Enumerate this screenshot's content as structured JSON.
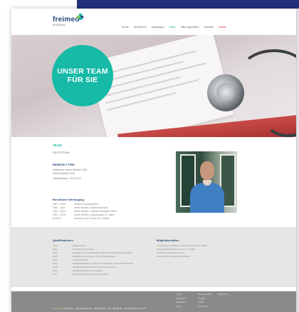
{
  "brand": {
    "name": "freimed",
    "subtitle": "ärztehaus",
    "colors": {
      "teal": "#17b9a7",
      "navy": "#2a4b7c",
      "red": "#e53935",
      "footer": "#8a8a8a"
    }
  },
  "nav": {
    "items": [
      "home",
      "ärztehaus",
      "leistungen",
      "team",
      "öffnungszeiten",
      "kontakt",
      "notfall"
    ],
    "active": "team"
  },
  "hero": {
    "line1": "UNSER TEAM",
    "line2": "FÜR SIE"
  },
  "team": {
    "title": "TEAM",
    "subtitle": "ÄRZTETEAM",
    "person": {
      "name": "BENEDIKT FREI",
      "lines": [
        "Allgemeine Innere Medizin FMH",
        "Hofmatt/partner 09%",
        "Gebutstdatum: 10.04.1972"
      ]
    },
    "career": {
      "title": "Beruflicher Werdegang",
      "rows": [
        {
          "year": "1993 – 1999",
          "text": "Studium Humanmedizin"
        },
        {
          "year": "1999 – 2001",
          "text": "Innere Medizin, Spital Wädenswil"
        },
        {
          "year": "2002 – 2004",
          "text": "Innere Medizin, Unispital Inselspital Zürich"
        },
        {
          "year": "2004 – 2005",
          "text": "Innere Medizin, Kantonsspital St. Gallen"
        },
        {
          "year": "ab 2007",
          "text": "Hausarzt in der Praxis Frei, Wattwil"
        }
      ]
    }
  },
  "qualifications": {
    "title": "Qualifikationen",
    "rows": [
      {
        "year": "1999",
        "text": "Staatsexamen"
      },
      {
        "year": "2000",
        "text": "Doktortitel der Medizin"
      },
      {
        "year": "2001",
        "text": "Bewilligung zur selbständigen ärztlichen Berufsausübung SGH"
      },
      {
        "year": "2005",
        "text": "Bewilligung zum Führen einer Privatapotheke"
      },
      {
        "year": "2007",
        "text": "Praxiseröffnung"
      },
      {
        "year": "2011",
        "text": "Fähigkeitsausweis Facharzt für Allgemeine Innere Medizin FMH"
      },
      {
        "year": "2013",
        "text": "Fähigkeitsausweis Ultraschall des Abdomens"
      },
      {
        "year": "2014",
        "text": "Fähigkeitsausweis Sonographie"
      },
      {
        "year": "2017",
        "text": "Fähigkeitsausweis Praxislabor FAMH"
      }
    ]
  },
  "memberships": {
    "title": "Mitgliedschaften",
    "rows": [
      "Vereinigung der Schweizer Ärztinnen und Ärzte FMH",
      "Ärztegesellschaft des Kantons St. Gallen",
      "Schweizer Hausarzt-Verband",
      "Zentrumsplatz Toggenburg Wattwil"
    ]
  },
  "footer": {
    "brand": "freimed ag",
    "address": "· ärztehaus · wattwilstrasse 66 · 9630 wattwil · t 071 988 35 35 · info@freimed-aerzte.ch",
    "col1": [
      "home",
      "ärztehaus",
      "leistungen",
      "team"
    ],
    "col2": [
      "öffnungszeiten",
      "kontakt",
      "notfall",
      "impressum"
    ],
    "col3": [
      "impressum"
    ]
  }
}
